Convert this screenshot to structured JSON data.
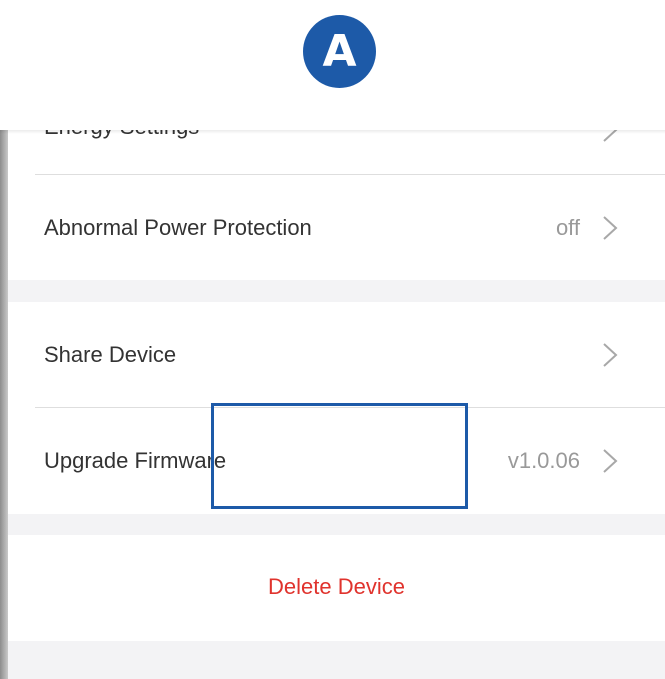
{
  "marker": {
    "letter": "A"
  },
  "settings": {
    "partial_row": {
      "label": "Energy Settings"
    },
    "abnormal_power": {
      "label": "Abnormal Power Protection",
      "value": "off"
    },
    "share": {
      "label": "Share Device"
    },
    "firmware": {
      "label": "Upgrade Firmware",
      "value": "v1.0.06"
    },
    "delete": {
      "label": "Delete Device"
    }
  },
  "colors": {
    "accent_blue": "#1d5aa8",
    "delete_red": "#e0332d",
    "text": "#333333",
    "muted": "#999999",
    "background": "#f3f3f5"
  }
}
